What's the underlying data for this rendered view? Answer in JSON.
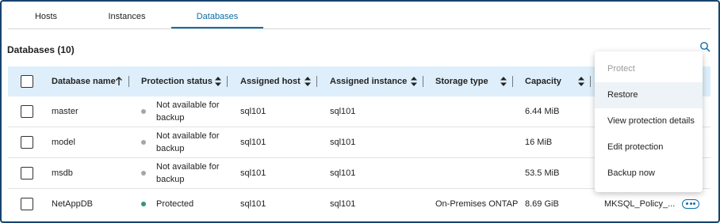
{
  "tabs": [
    {
      "label": "Hosts"
    },
    {
      "label": "Instances"
    },
    {
      "label": "Databases",
      "active": true
    }
  ],
  "section": {
    "title": "Databases (10)"
  },
  "icons": {
    "search": "search-icon",
    "sort": "sort-icon",
    "sort_asc": "arrow-up-icon",
    "more": "more-icon"
  },
  "table": {
    "columns": [
      "Database name",
      "Protection status",
      "Assigned host",
      "Assigned instance",
      "Storage type",
      "Capacity"
    ],
    "rows": [
      {
        "name": "master",
        "status": "Not available for backup",
        "status_color": "#a6a6a6",
        "host": "sql101",
        "instance": "sql101",
        "storage": "",
        "capacity": "6.44 MiB",
        "policy": ""
      },
      {
        "name": "model",
        "status": "Not available for backup",
        "status_color": "#a6a6a6",
        "host": "sql101",
        "instance": "sql101",
        "storage": "",
        "capacity": "16 MiB",
        "policy": ""
      },
      {
        "name": "msdb",
        "status": "Not available for backup",
        "status_color": "#a6a6a6",
        "host": "sql101",
        "instance": "sql101",
        "storage": "",
        "capacity": "53.5 MiB",
        "policy": ""
      },
      {
        "name": "NetAppDB",
        "status": "Protected",
        "status_color": "#2e9a6b",
        "host": "sql101",
        "instance": "sql101",
        "storage": "On-Premises ONTAP",
        "capacity": "8.69 GiB",
        "policy": "MKSQL_Policy_..."
      }
    ]
  },
  "menu": {
    "items": [
      {
        "label": "Protect",
        "disabled": true
      },
      {
        "label": "Restore",
        "hover": true
      },
      {
        "label": "View protection details"
      },
      {
        "label": "Edit protection"
      },
      {
        "label": "Backup now"
      }
    ]
  },
  "colors": {
    "accent": "#0b6ea8",
    "header_bg": "#deeffb",
    "frame": "#16436e"
  }
}
